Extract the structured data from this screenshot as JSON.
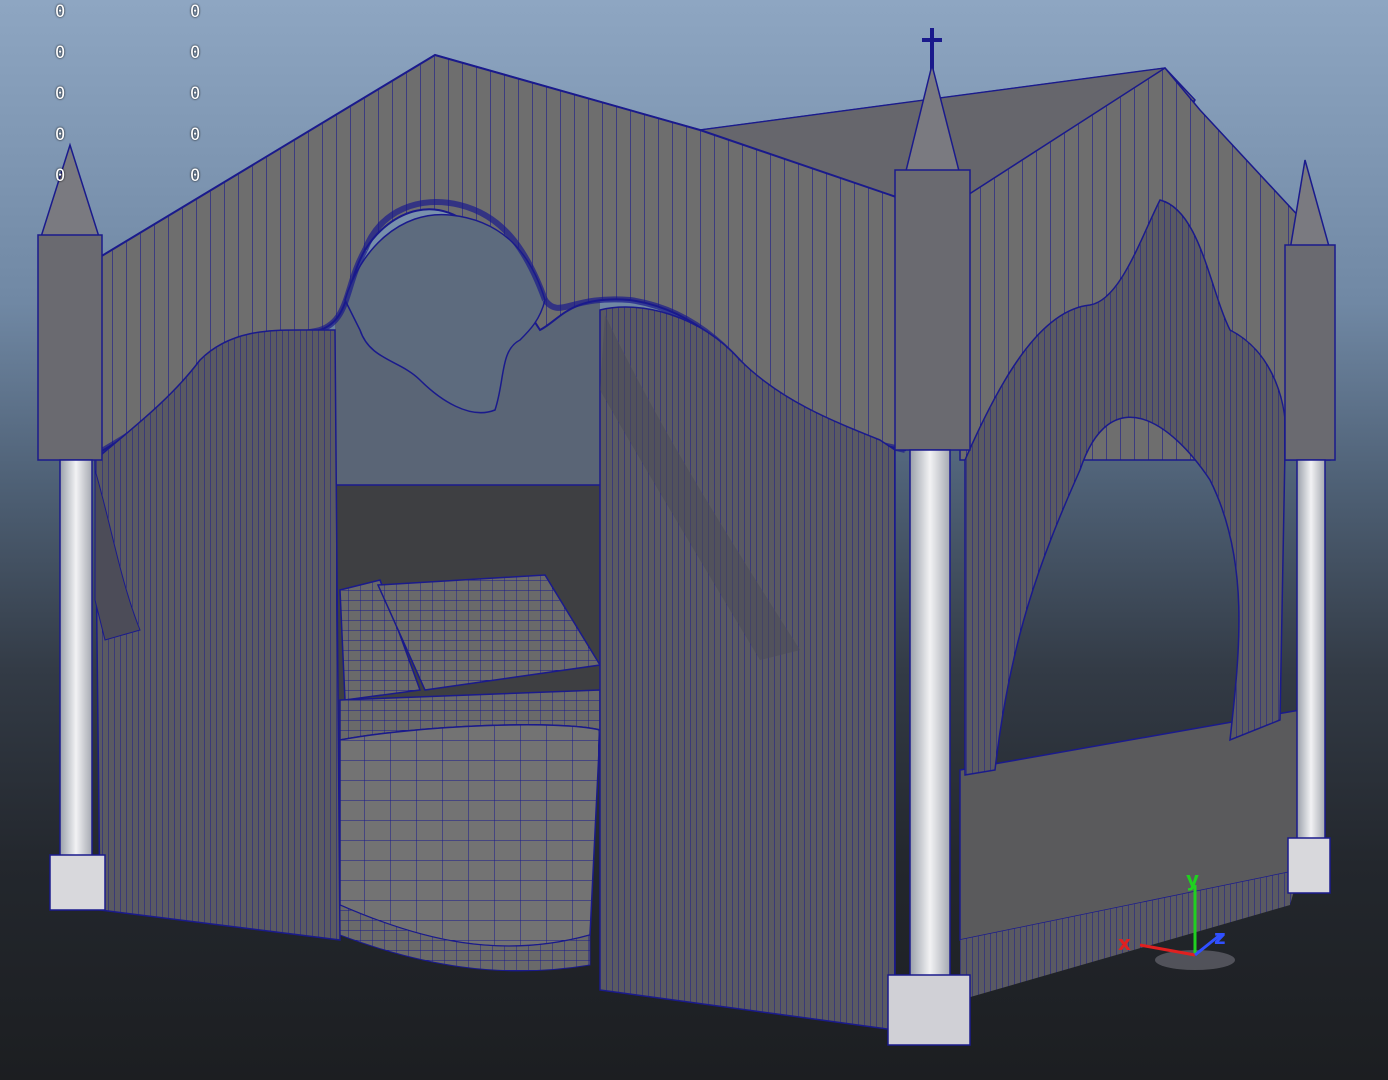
{
  "viewport": {
    "object": "four-poster-canopy-bed",
    "wire_color": "#1a1a8c",
    "surface_color": "#6c6c6c"
  },
  "hud": {
    "left_column": [
      "0",
      "0",
      "0",
      "0",
      "0"
    ],
    "right_column": [
      "0",
      "0",
      "0",
      "0",
      "0"
    ]
  },
  "axis_gizmo": {
    "x_label": "x",
    "y_label": "y",
    "z_label": "z",
    "x_color": "#e02020",
    "y_color": "#20d020",
    "z_color": "#3050ff"
  }
}
